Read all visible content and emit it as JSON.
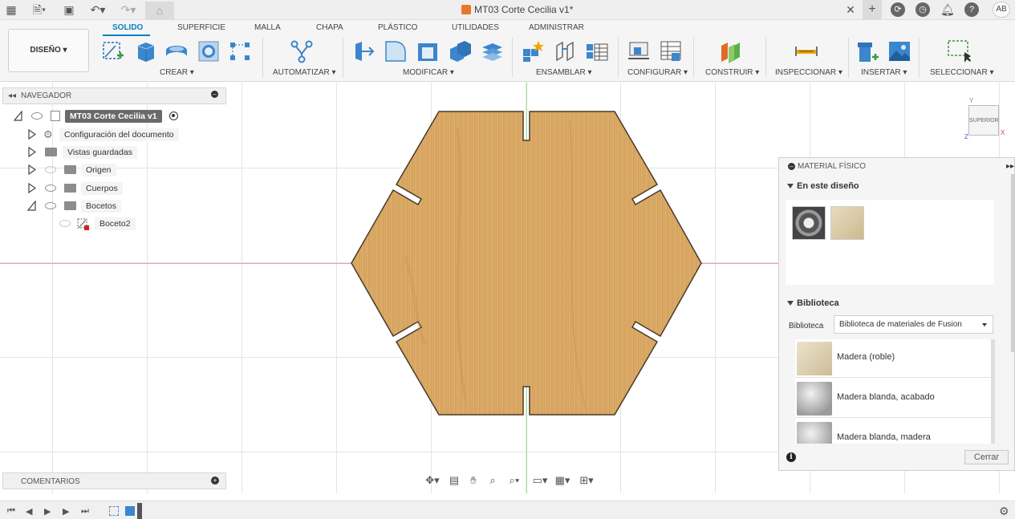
{
  "window": {
    "title": "MT03 Corte Cecilia v1*",
    "user_initials": "AB"
  },
  "ribbon": {
    "workspace_button": "DISEÑO",
    "tabs": [
      "SOLIDO",
      "SUPERFICIE",
      "MALLA",
      "CHAPA",
      "PLÁSTICO",
      "UTILIDADES",
      "ADMINISTRAR"
    ],
    "active_tab": "SOLIDO",
    "groups": [
      "CREAR",
      "AUTOMATIZAR",
      "MODIFICAR",
      "ENSAMBLAR",
      "CONFIGURAR",
      "CONSTRUIR",
      "INSPECCIONAR",
      "INSERTAR",
      "SELECCIONAR"
    ]
  },
  "browser": {
    "title": "NAVEGADOR",
    "root": "MT03 Corte Cecilia v1",
    "items": [
      {
        "label": "Configuración del documento",
        "icon": "gear-icon"
      },
      {
        "label": "Vistas guardadas",
        "icon": "folder-icon"
      },
      {
        "label": "Origen",
        "icon": "folder-icon"
      },
      {
        "label": "Cuerpos",
        "icon": "folder-icon"
      },
      {
        "label": "Bocetos",
        "icon": "folder-icon"
      },
      {
        "label": "Boceto2",
        "icon": "sketch-icon"
      }
    ]
  },
  "comments": {
    "title": "COMENTARIOS"
  },
  "viewcube": {
    "face_label": "SUPERIOR"
  },
  "material_panel": {
    "title": "MATERIAL FÍSICO",
    "in_design_title": "En este diseño",
    "library_section": "Biblioteca",
    "library_label": "Biblioteca",
    "library_selected": "Biblioteca de materiales de Fusion",
    "materials": [
      {
        "name": "Madera (roble)",
        "swatch": "#d9cdb0"
      },
      {
        "name": "Madera blanda, acabado",
        "swatch": "#bdbdbd"
      },
      {
        "name": "Madera blanda, madera",
        "swatch": "#c4c4c4"
      }
    ],
    "close_button": "Cerrar"
  },
  "colors": {
    "accent": "#0a7fc4",
    "wood": "#d9a35a",
    "wood_dark": "#c98f45"
  }
}
